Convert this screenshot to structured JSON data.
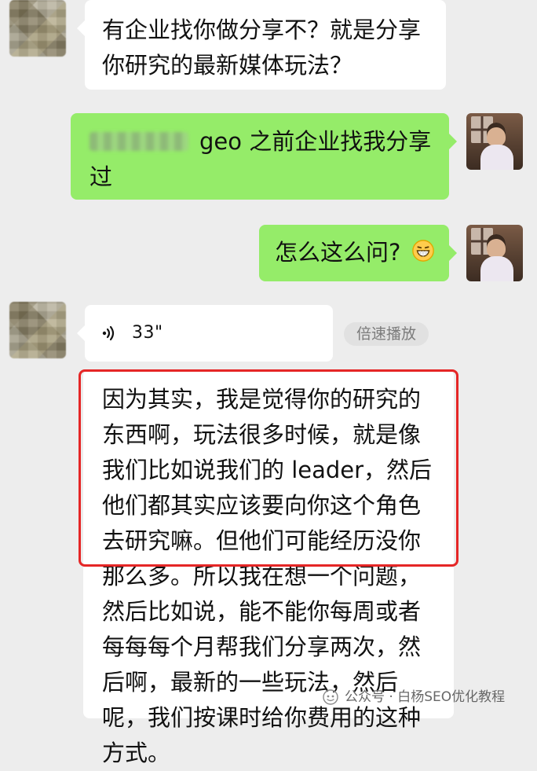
{
  "chat": {
    "messages": [
      {
        "text_lines": [
          "有企业找你做分享不？就是分享",
          "你研究的最新媒体玩法？"
        ]
      },
      {
        "text_lines": [
          "geo 之前企业找我分享",
          "过"
        ]
      },
      {
        "text": "怎么这么问?",
        "emoji": "grinning-face-emoji"
      },
      {
        "voice_duration": "33\"",
        "speed_label": "倍速播放"
      },
      {
        "transcript_lines": [
          "因为其实，我是觉得你的研究的",
          "东西啊，玩法很多时候，就是像",
          "我们比如说我们的 leader，然后",
          "他们都其实应该要向你这个角色",
          "去研究嘛。但他们可能经历没你",
          "那么多。所以我在想一个问题，",
          "然后比如说，能不能你每周或者",
          "每每每个月帮我们分享两次，然",
          "后啊，最新的一些玩法，然后",
          "呢，我们按课时给你费用的这种",
          "方式。"
        ]
      }
    ]
  },
  "watermark": {
    "text": "公众号 · 白杨SEO优化教程",
    "icon": "wechat-official-account-icon"
  },
  "colors": {
    "background": "#ededed",
    "incoming_bubble": "#ffffff",
    "outgoing_bubble": "#95ec69",
    "highlight": "#e52626"
  }
}
